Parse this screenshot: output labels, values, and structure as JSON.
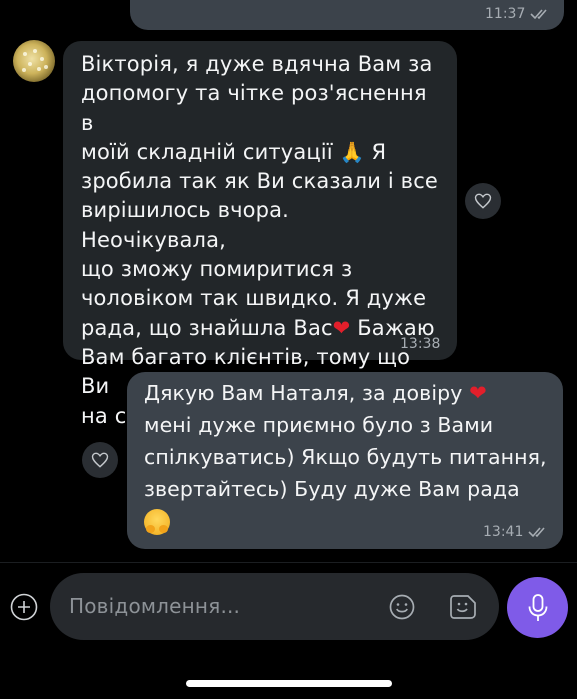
{
  "messages": {
    "prev_outgoing": {
      "time": "11:37"
    },
    "incoming": {
      "line1": "Вікторія, я дуже вдячна Вам за",
      "line2": "допомогу та чітке роз'яснення в",
      "line3a": "моїй складній ситуації ",
      "line3_emoji": "🙏",
      "line3b": " Я",
      "line4": "зробила так як Ви сказали і все",
      "line5": "вирішилось вчора. Неочікувала,",
      "line6": "що зможу помиритися з",
      "line7": "чоловіком так швидко. Я дуже",
      "line8a": "рада, що знайшла Вас",
      "line8_emoji": "❤",
      "line8b": "  Бажаю",
      "line9": "Вам багато клієнтів,  тому що Ви",
      "line10": "на своєму місці!",
      "time": "13:38"
    },
    "outgoing": {
      "line1a": "Дякую Вам Наталя, за довіру ",
      "line1_emoji": "❤",
      "line2": "мені дуже приємно було з Вами",
      "line3": "спілкуватись) Якщо будуть питання,",
      "line4": "звертайтесь) Буду дуже Вам рада",
      "time": "13:41"
    }
  },
  "composer": {
    "placeholder": "Повідомлення..."
  },
  "colors": {
    "accent": "#7f5be8",
    "incoming_bubble": "#222629",
    "outgoing_bubble": "#3c434b"
  },
  "icons": [
    "double-check-icon",
    "heart-outline-icon",
    "plus-circle-icon",
    "smiley-icon",
    "sticker-icon",
    "microphone-icon"
  ]
}
